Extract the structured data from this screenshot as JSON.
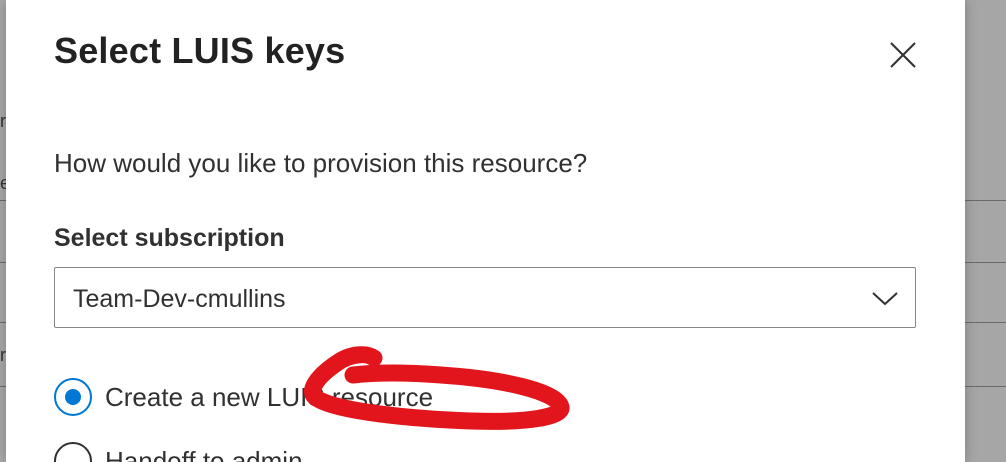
{
  "dialog": {
    "title": "Select LUIS keys",
    "close_icon": "close-icon",
    "question": "How would you like to provision this resource?",
    "subscription_label": "Select subscription",
    "subscription_value": "Team-Dev-cmullins",
    "options": [
      {
        "label": "Create a new LUIS resource",
        "selected": true
      },
      {
        "label": "Handoff to admin",
        "selected": false
      }
    ]
  },
  "background": {
    "glyphs": [
      "r",
      "e",
      "r"
    ]
  },
  "colors": {
    "accent": "#0078d4",
    "annotation": "#e3151c",
    "overlay": "#9a9a9a"
  }
}
